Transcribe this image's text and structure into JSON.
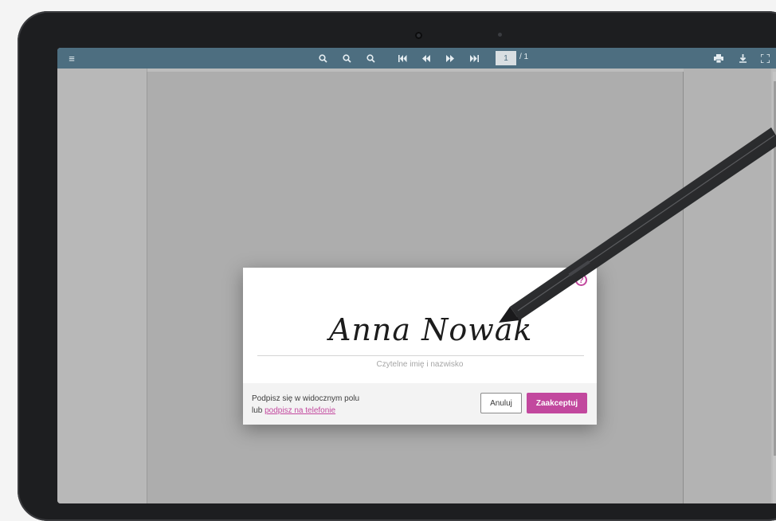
{
  "toolbar": {
    "menu_icon": "≡",
    "zoom_in_icon": "🔍",
    "zoom_reset_icon": "🔍",
    "zoom_out_icon": "🔍",
    "first_page_icon": "⏮",
    "prev_page_icon": "⏪",
    "next_page_icon": "⏩",
    "last_page_icon": "⏭",
    "current_page": "1",
    "page_total": "/ 1",
    "print_icon": "🖶",
    "download_icon": "⭳",
    "fullscreen_icon": "⛶"
  },
  "dialog": {
    "help_icon": "?",
    "signature": "Anna Nowak",
    "signature_hint": "Czytelne imię i nazwisko",
    "instruction_line1": "Podpisz się w widocznym polu",
    "instruction_prefix": "lub ",
    "phone_link": "podpisz na telefonie",
    "cancel_label": "Anuluj",
    "accept_label": "Zaakceptuj"
  },
  "colors": {
    "toolbar": "#4d6e80",
    "accent": "#c2489e"
  }
}
